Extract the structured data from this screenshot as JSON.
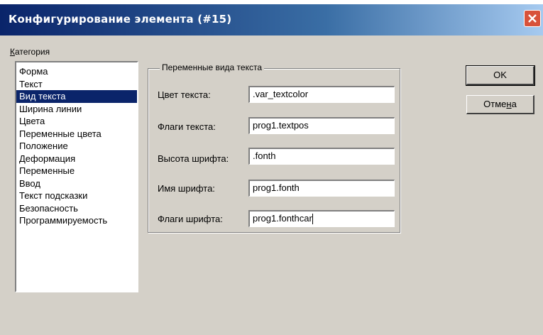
{
  "window": {
    "title": "Конфигурирование элемента (#15)",
    "close_icon": "close-icon"
  },
  "category": {
    "label_first": "К",
    "label_rest": "атегория",
    "items": [
      {
        "label": "Форма"
      },
      {
        "label": "Текст"
      },
      {
        "label": "Вид текста",
        "selected": true
      },
      {
        "label": "Ширина линии"
      },
      {
        "label": "Цвета"
      },
      {
        "label": "Переменные цвета"
      },
      {
        "label": "Положение"
      },
      {
        "label": "Деформация"
      },
      {
        "label": "Переменные"
      },
      {
        "label": "Ввод"
      },
      {
        "label": "Текст подсказки"
      },
      {
        "label": "Безопасность"
      },
      {
        "label": "Программируемость"
      }
    ]
  },
  "group": {
    "legend": "Переменные вида текста",
    "rows": [
      {
        "label": "Цвет текста:",
        "value": ".var_textcolor"
      },
      {
        "label": "Флаги текста:",
        "value": "prog1.textpos"
      },
      {
        "label": "Высота шрифта:",
        "value": ".fonth"
      },
      {
        "label": "Имя шрифта:",
        "value": "prog1.fonth"
      },
      {
        "label": "Флаги шрифта:",
        "value": "prog1.fonthcar"
      }
    ]
  },
  "buttons": {
    "ok_label": "OK",
    "cancel_label_before": "Отме",
    "cancel_label_u": "н",
    "cancel_label_after": "а"
  }
}
